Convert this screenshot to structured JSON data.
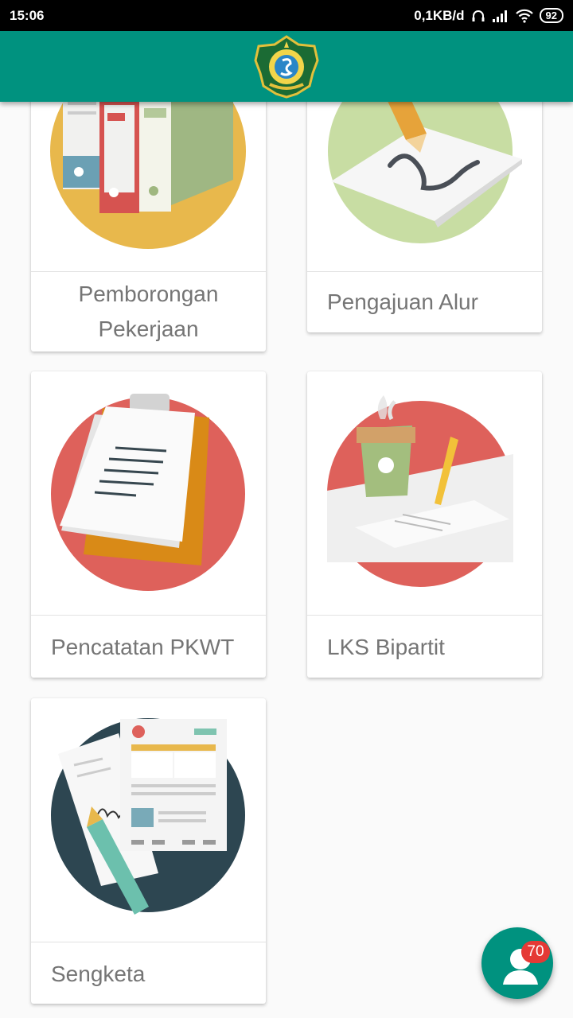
{
  "status_bar": {
    "time": "15:06",
    "speed": "0,1KB/d",
    "battery": "92"
  },
  "app_bar": {
    "logo_icon": "east-java-province-emblem"
  },
  "cards": [
    {
      "label_line1": "Pemborongan",
      "label_line2": "Pekerjaan",
      "icon": "binders-illustration"
    },
    {
      "label": "Pengajuan Alur",
      "icon": "signature-pen-illustration"
    },
    {
      "label": "Pencatatan PKWT",
      "icon": "clipboard-illustration"
    },
    {
      "label": "LKS Bipartit",
      "icon": "coffee-pencil-paper-illustration"
    },
    {
      "label": "Sengketa",
      "icon": "contract-fountain-pen-illustration"
    }
  ],
  "fab": {
    "icon": "user-icon",
    "badge": "70"
  },
  "colors": {
    "primary": "#00927f",
    "badge": "#e53935"
  }
}
